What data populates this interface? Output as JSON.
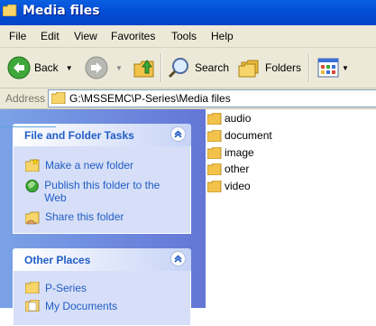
{
  "window": {
    "title": "Media files"
  },
  "menu": [
    "File",
    "Edit",
    "View",
    "Favorites",
    "Tools",
    "Help"
  ],
  "toolbar": {
    "back_label": "Back",
    "search_label": "Search",
    "folders_label": "Folders"
  },
  "address": {
    "label": "Address",
    "path": "G:\\MSSEMC\\P-Series\\Media files"
  },
  "tasks_panel": {
    "title": "File and Folder Tasks",
    "links": [
      "Make a new folder",
      "Publish this folder to the Web",
      "Share this folder"
    ]
  },
  "places_panel": {
    "title": "Other Places",
    "links": [
      "P-Series",
      "My Documents"
    ]
  },
  "files": [
    "audio",
    "document",
    "image",
    "other",
    "video"
  ],
  "colors": {
    "titlebar": "#0450d8",
    "task_link": "#215dc6",
    "pane_bg": "#6f8ce0",
    "folder": "#f2c24a"
  }
}
